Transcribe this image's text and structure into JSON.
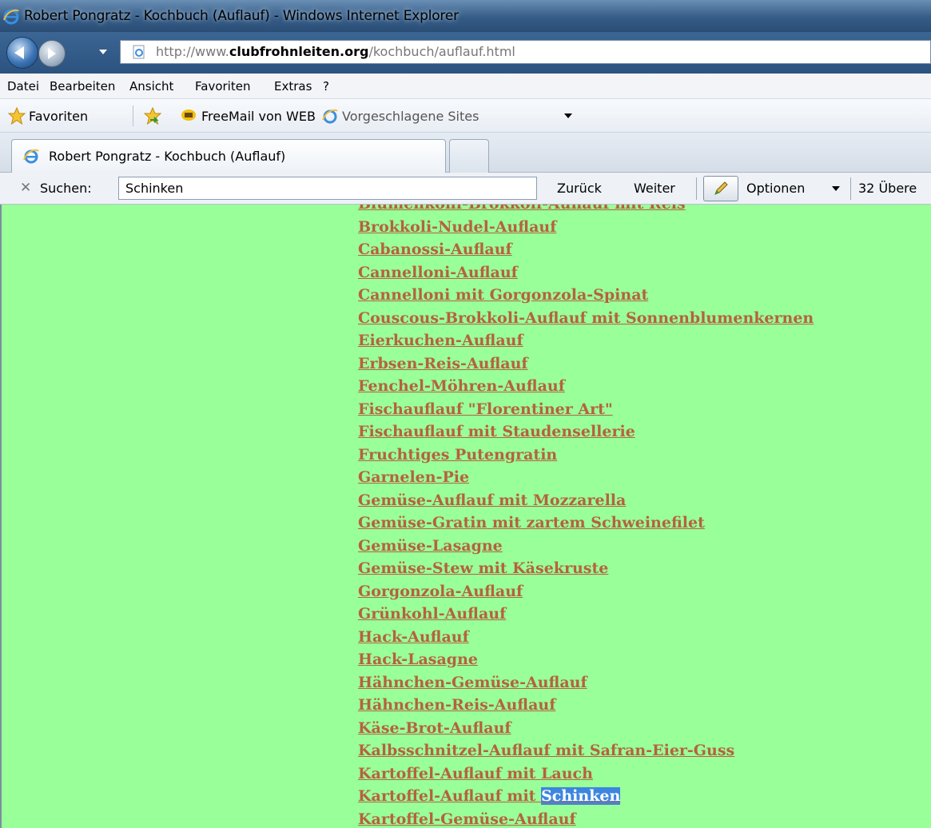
{
  "window": {
    "title": "Robert Pongratz - Kochbuch (Auflauf) - Windows Internet Explorer"
  },
  "address": {
    "url_prefix": "http://www.",
    "url_domain": "clubfrohnleiten.org",
    "url_path": "/kochbuch/auflauf.html"
  },
  "menu": [
    "Datei",
    "Bearbeiten",
    "Ansicht",
    "Favoriten",
    "Extras",
    "?"
  ],
  "favorites": {
    "favorites_label": "Favoriten",
    "freemail_label": "FreeMail von WEB",
    "suggested_label": "Vorgeschlagene Sites"
  },
  "tab": {
    "label": "Robert Pongratz - Kochbuch (Auflauf)"
  },
  "find": {
    "label": "Suchen:",
    "value": "Schinken",
    "back_label": "Zurück",
    "next_label": "Weiter",
    "options_label": "Optionen",
    "matches_label": "32 Übere"
  },
  "recipes": [
    "Blumenkohl-Brokkoli-Auflauf mit Reis",
    "Brokkoli-Nudel-Auflauf",
    "Cabanossi-Auflauf",
    "Cannelloni-Auflauf",
    "Cannelloni mit Gorgonzola-Spinat",
    "Couscous-Brokkoli-Auflauf mit Sonnenblumenkernen",
    "Eierkuchen-Auflauf",
    "Erbsen-Reis-Auflauf",
    "Fenchel-Möhren-Auflauf",
    "Fischauflauf \"Florentiner Art\"",
    "Fischauflauf mit Staudensellerie",
    "Fruchtiges Putengratin",
    "Garnelen-Pie",
    "Gemüse-Auflauf mit Mozzarella",
    "Gemüse-Gratin mit zartem Schweinefilet",
    "Gemüse-Lasagne",
    "Gemüse-Stew mit Käsekruste",
    "Gorgonzola-Auflauf",
    "Grünkohl-Auflauf",
    "Hack-Auflauf",
    "Hack-Lasagne",
    "Hähnchen-Gemüse-Auflauf",
    "Hähnchen-Reis-Auflauf",
    "Käse-Brot-Auflauf",
    "Kalbsschnitzel-Auflauf mit Safran-Eier-Guss",
    "Kartoffel-Auflauf mit Lauch",
    "Kartoffel-Auflauf mit Schinken",
    "Kartoffel-Gemüse-Auflauf"
  ],
  "highlight": {
    "recipe_index": 26,
    "term": "Schinken"
  },
  "colors": {
    "page_bg": "#99ff99",
    "link": "#b5623e",
    "highlight": "#3d86e0"
  }
}
